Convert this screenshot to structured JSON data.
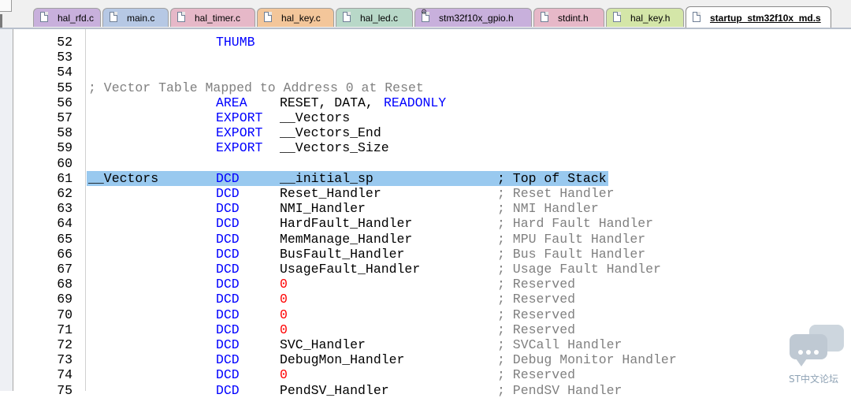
{
  "tabs": [
    {
      "label": "hal_rfd.c",
      "color": "#c8b0dc",
      "icon": "c-file-icon",
      "active": false
    },
    {
      "label": "main.c",
      "color": "#b6c8e4",
      "icon": "c-file-icon",
      "active": false
    },
    {
      "label": "hal_timer.c",
      "color": "#e6b8c8",
      "icon": "c-file-icon",
      "active": false
    },
    {
      "label": "hal_key.c",
      "color": "#f3c69a",
      "icon": "c-file-icon",
      "active": false
    },
    {
      "label": "hal_led.c",
      "color": "#b8d8c8",
      "icon": "c-file-icon",
      "active": false
    },
    {
      "label": "stm32f10x_gpio.h",
      "color": "#c8b0dc",
      "icon": "h-file-gear-icon",
      "active": false
    },
    {
      "label": "stdint.h",
      "color": "#e6b8c8",
      "icon": "h-file-icon",
      "active": false
    },
    {
      "label": "hal_key.h",
      "color": "#d4e6a8",
      "icon": "h-file-icon",
      "active": false
    },
    {
      "label": "startup_stm32f10x_md.s",
      "color": "#ffffff",
      "icon": "asm-file-icon",
      "active": true
    }
  ],
  "editor": {
    "lines": [
      {
        "num": "52",
        "label": "",
        "instr": "THUMB",
        "operand": "",
        "comment": "",
        "full_comment": "",
        "highlight": false
      },
      {
        "num": "53",
        "label": "",
        "instr": "",
        "operand": "",
        "comment": "",
        "full_comment": "",
        "highlight": false
      },
      {
        "num": "54",
        "label": "",
        "instr": "",
        "operand": "",
        "comment": "",
        "full_comment": "",
        "highlight": false
      },
      {
        "num": "55",
        "label": "",
        "instr": "",
        "operand": "",
        "comment": "",
        "full_comment": "; Vector Table Mapped to Address 0 at Reset",
        "highlight": false
      },
      {
        "num": "56",
        "label": "",
        "instr": "AREA",
        "operand": "RESET, DATA,",
        "operand_kw": "READONLY",
        "comment": "",
        "full_comment": "",
        "highlight": false
      },
      {
        "num": "57",
        "label": "",
        "instr": "EXPORT",
        "operand": "__Vectors",
        "comment": "",
        "full_comment": "",
        "highlight": false
      },
      {
        "num": "58",
        "label": "",
        "instr": "EXPORT",
        "operand": "__Vectors_End",
        "comment": "",
        "full_comment": "",
        "highlight": false
      },
      {
        "num": "59",
        "label": "",
        "instr": "EXPORT",
        "operand": "__Vectors_Size",
        "comment": "",
        "full_comment": "",
        "highlight": false
      },
      {
        "num": "60",
        "label": "",
        "instr": "",
        "operand": "",
        "comment": "",
        "full_comment": "",
        "highlight": false
      },
      {
        "num": "61",
        "label": "__Vectors",
        "instr": "DCD",
        "operand": "__initial_sp",
        "comment": "; Top of Stack",
        "full_comment": "",
        "highlight": true
      },
      {
        "num": "62",
        "label": "",
        "instr": "DCD",
        "operand": "Reset_Handler",
        "comment": "; Reset Handler",
        "full_comment": "",
        "highlight": false
      },
      {
        "num": "63",
        "label": "",
        "instr": "DCD",
        "operand": "NMI_Handler",
        "comment": "; NMI Handler",
        "full_comment": "",
        "highlight": false
      },
      {
        "num": "64",
        "label": "",
        "instr": "DCD",
        "operand": "HardFault_Handler",
        "comment": "; Hard Fault Handler",
        "full_comment": "",
        "highlight": false
      },
      {
        "num": "65",
        "label": "",
        "instr": "DCD",
        "operand": "MemManage_Handler",
        "comment": "; MPU Fault Handler",
        "full_comment": "",
        "highlight": false
      },
      {
        "num": "66",
        "label": "",
        "instr": "DCD",
        "operand": "BusFault_Handler",
        "comment": "; Bus Fault Handler",
        "full_comment": "",
        "highlight": false
      },
      {
        "num": "67",
        "label": "",
        "instr": "DCD",
        "operand": "UsageFault_Handler",
        "comment": "; Usage Fault Handler",
        "full_comment": "",
        "highlight": false
      },
      {
        "num": "68",
        "label": "",
        "instr": "DCD",
        "operand": "0",
        "comment": "; Reserved",
        "full_comment": "",
        "highlight": false
      },
      {
        "num": "69",
        "label": "",
        "instr": "DCD",
        "operand": "0",
        "comment": "; Reserved",
        "full_comment": "",
        "highlight": false
      },
      {
        "num": "70",
        "label": "",
        "instr": "DCD",
        "operand": "0",
        "comment": "; Reserved",
        "full_comment": "",
        "highlight": false
      },
      {
        "num": "71",
        "label": "",
        "instr": "DCD",
        "operand": "0",
        "comment": "; Reserved",
        "full_comment": "",
        "highlight": false
      },
      {
        "num": "72",
        "label": "",
        "instr": "DCD",
        "operand": "SVC_Handler",
        "comment": "; SVCall Handler",
        "full_comment": "",
        "highlight": false
      },
      {
        "num": "73",
        "label": "",
        "instr": "DCD",
        "operand": "DebugMon_Handler",
        "comment": "; Debug Monitor Handler",
        "full_comment": "",
        "highlight": false
      },
      {
        "num": "74",
        "label": "",
        "instr": "DCD",
        "operand": "0",
        "comment": "; Reserved",
        "full_comment": "",
        "highlight": false
      },
      {
        "num": "75",
        "label": "",
        "instr": "DCD",
        "operand": "PendSV_Handler",
        "comment": "; PendSV Handler",
        "full_comment": "",
        "highlight": false
      }
    ],
    "colors": {
      "keyword": "#0000ff",
      "comment": "#808080",
      "number": "#ff0000",
      "selection": "#99c9ef"
    }
  },
  "watermark": {
    "text": "ST中文论坛",
    "icon": "chat-bubbles-icon"
  }
}
